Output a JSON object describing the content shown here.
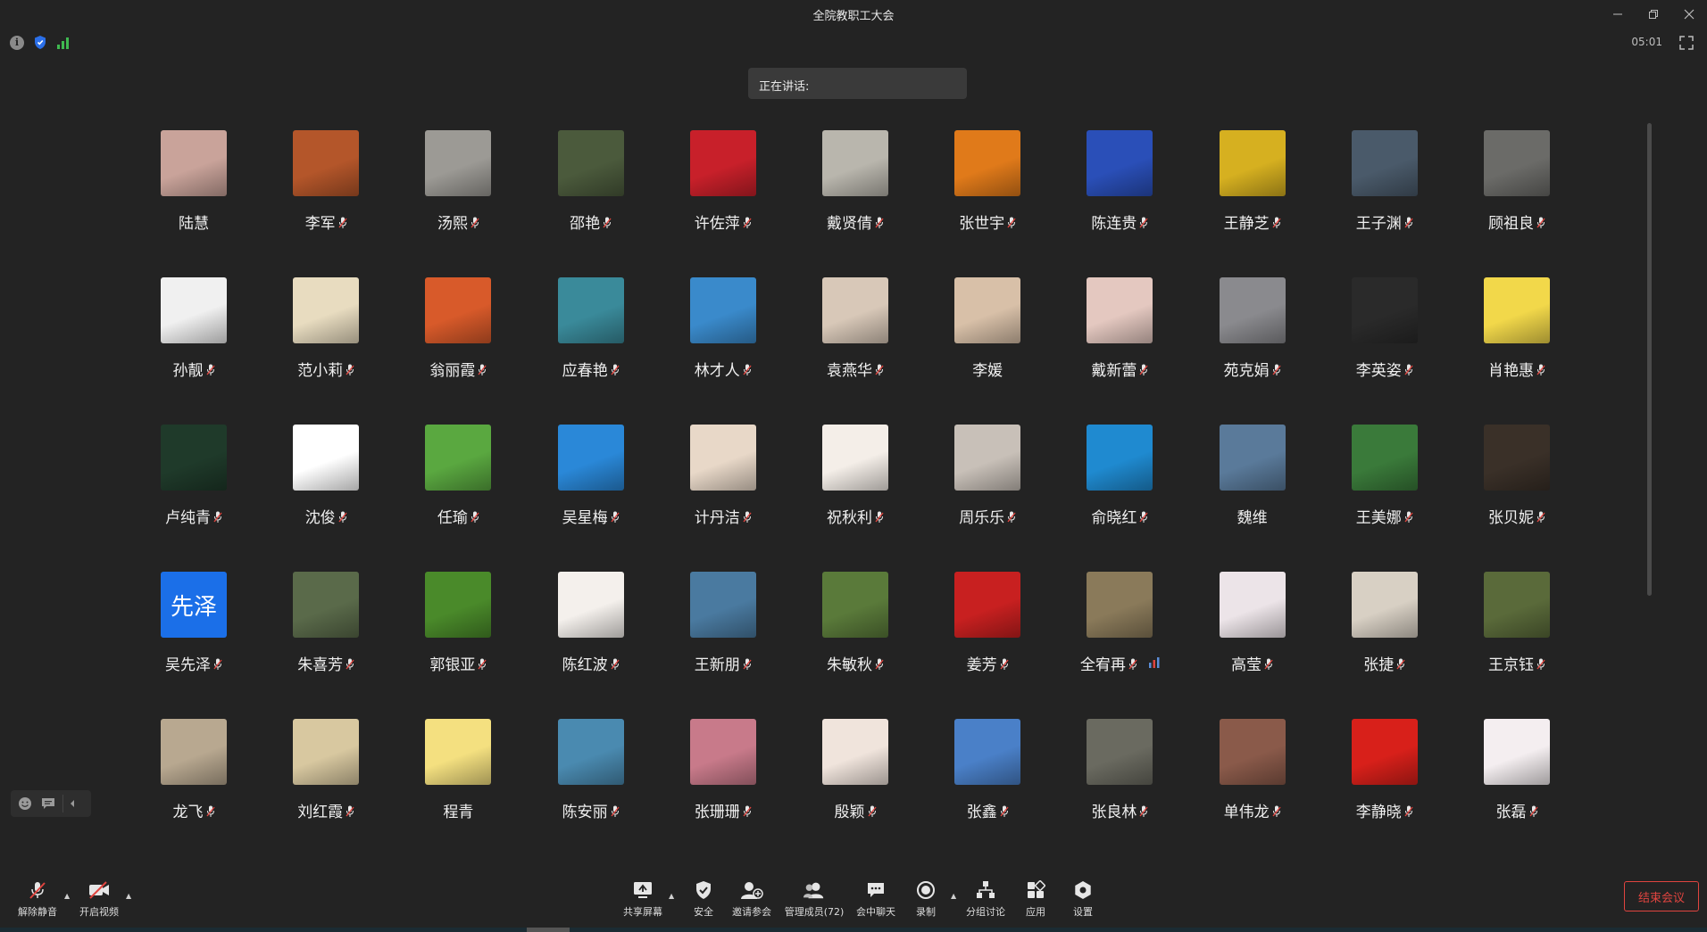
{
  "window": {
    "title": "全院教职工大会",
    "controls": [
      "minimize-icon",
      "restore-icon",
      "close-icon"
    ]
  },
  "info_bar": {
    "icons": [
      "info-icon",
      "shield-icon",
      "signal-icon"
    ],
    "timer": "05:01"
  },
  "speaking": {
    "label": "正在讲话:"
  },
  "colors": {
    "background": "#232323",
    "accent_blue": "#2b6fe8",
    "end_red": "#e0443f",
    "signal_green": "#3fb950"
  },
  "participants": [
    {
      "name": "陆慧",
      "muted": false,
      "color": "#c9a39a"
    },
    {
      "name": "李军",
      "muted": true,
      "color": "#b4562a"
    },
    {
      "name": "汤熙",
      "muted": true,
      "color": "#9c9a95"
    },
    {
      "name": "邵艳",
      "muted": true,
      "color": "#4b5a3c"
    },
    {
      "name": "许佐萍",
      "muted": true,
      "color": "#c8202a"
    },
    {
      "name": "戴贤倩",
      "muted": true,
      "color": "#b9b6ad"
    },
    {
      "name": "张世宇",
      "muted": true,
      "color": "#e07a1a"
    },
    {
      "name": "陈连贵",
      "muted": true,
      "color": "#2a4fb8"
    },
    {
      "name": "王静芝",
      "muted": true,
      "color": "#d6b020"
    },
    {
      "name": "王子渊",
      "muted": true,
      "color": "#4a5a6a"
    },
    {
      "name": "顾祖良",
      "muted": true,
      "color": "#6b6b68"
    },
    {
      "name": "孙靓",
      "muted": true,
      "color": "#f0f0f0"
    },
    {
      "name": "范小莉",
      "muted": true,
      "color": "#e8dcc0"
    },
    {
      "name": "翁丽霞",
      "muted": true,
      "color": "#d85a2a"
    },
    {
      "name": "应春艳",
      "muted": true,
      "color": "#3a8a9a"
    },
    {
      "name": "林才人",
      "muted": true,
      "color": "#3a8acb"
    },
    {
      "name": "袁燕华",
      "muted": true,
      "color": "#d8c8b8"
    },
    {
      "name": "李媛",
      "muted": false,
      "color": "#d8c0a8"
    },
    {
      "name": "戴新蕾",
      "muted": true,
      "color": "#e4c8c0"
    },
    {
      "name": "苑克娟",
      "muted": true,
      "color": "#8a8a8e"
    },
    {
      "name": "李英姿",
      "muted": true,
      "color": "#2a2a2a"
    },
    {
      "name": "肖艳惠",
      "muted": true,
      "color": "#f2d84a"
    },
    {
      "name": "卢纯青",
      "muted": true,
      "color": "#1f3a2a"
    },
    {
      "name": "沈俊",
      "muted": true,
      "color": "#ffffff"
    },
    {
      "name": "任瑜",
      "muted": true,
      "color": "#5aa840"
    },
    {
      "name": "吴星梅",
      "muted": true,
      "color": "#2a88d8"
    },
    {
      "name": "计丹洁",
      "muted": true,
      "color": "#e8d8c8"
    },
    {
      "name": "祝秋利",
      "muted": true,
      "color": "#f4eee8"
    },
    {
      "name": "周乐乐",
      "muted": true,
      "color": "#c8c0b8"
    },
    {
      "name": "俞晓红",
      "muted": true,
      "color": "#1f8ad0"
    },
    {
      "name": "魏维",
      "muted": false,
      "color": "#5a7a9a"
    },
    {
      "name": "王美娜",
      "muted": true,
      "color": "#3a7a3a"
    },
    {
      "name": "张贝妮",
      "muted": true,
      "color": "#3a3028"
    },
    {
      "name": "吴先泽",
      "muted": true,
      "color": "#1b6fe8",
      "text_avatar": "先泽"
    },
    {
      "name": "朱喜芳",
      "muted": true,
      "color": "#5a6a4a"
    },
    {
      "name": "郭银亚",
      "muted": true,
      "color": "#4a8a2a"
    },
    {
      "name": "陈红波",
      "muted": true,
      "color": "#f4f0ec"
    },
    {
      "name": "王新朋",
      "muted": true,
      "color": "#4a7aa0"
    },
    {
      "name": "朱敏秋",
      "muted": true,
      "color": "#5a7a3a"
    },
    {
      "name": "姜芳",
      "muted": true,
      "color": "#c82020"
    },
    {
      "name": "全宥再",
      "muted": true,
      "color": "#8a7a5a",
      "speaking_bars": true
    },
    {
      "name": "高莹",
      "muted": true,
      "color": "#ece4e8"
    },
    {
      "name": "张捷",
      "muted": true,
      "color": "#d8d0c4"
    },
    {
      "name": "王京钰",
      "muted": true,
      "color": "#5a6a3a"
    },
    {
      "name": "龙飞",
      "muted": true,
      "color": "#b8a890"
    },
    {
      "name": "刘红霞",
      "muted": true,
      "color": "#d8c8a0"
    },
    {
      "name": "程青",
      "muted": false,
      "color": "#f4e080"
    },
    {
      "name": "陈安丽",
      "muted": true,
      "color": "#4a8ab0"
    },
    {
      "name": "张珊珊",
      "muted": true,
      "color": "#c87a8a"
    },
    {
      "name": "殷颖",
      "muted": true,
      "color": "#f0e4dc"
    },
    {
      "name": "张鑫",
      "muted": true,
      "color": "#4a80c8"
    },
    {
      "name": "张良林",
      "muted": true,
      "color": "#6a6a60"
    },
    {
      "name": "单伟龙",
      "muted": true,
      "color": "#8a5a4a"
    },
    {
      "name": "李静晓",
      "muted": true,
      "color": "#d8201a"
    },
    {
      "name": "张磊",
      "muted": true,
      "color": "#f4eef0"
    }
  ],
  "toolbar": {
    "unmute": "解除静音",
    "start_video": "开启视频",
    "share_screen": "共享屏幕",
    "security": "安全",
    "invite": "邀请参会",
    "manage_members": "管理成员(72)",
    "chat": "会中聊天",
    "record": "录制",
    "breakout": "分组讨论",
    "apps": "应用",
    "settings": "设置",
    "end_meeting": "结束会议"
  }
}
